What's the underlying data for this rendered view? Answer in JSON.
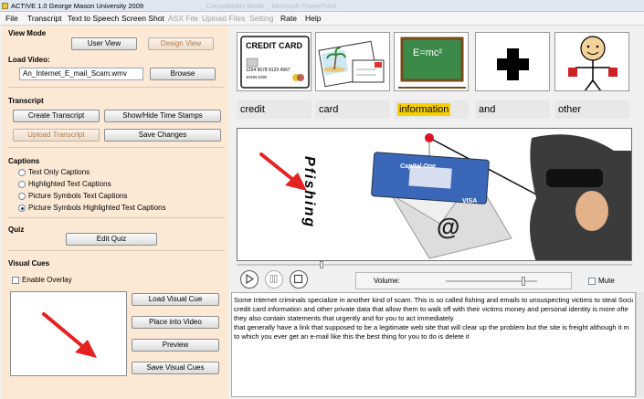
{
  "window": {
    "title": "ACTIVE 1.0 George Mason University 2009",
    "title_overflow": "_ Compatibility Mode _ Microsoft PowerPoint"
  },
  "menu": [
    "File",
    "Transcript",
    "Text to Speech",
    "Screen Shot",
    "ASX File",
    "Upload Files",
    "Setting",
    "Rate",
    "Help"
  ],
  "menu_disabled": [
    "ASX File",
    "Upload Files",
    "Setting"
  ],
  "view_mode": {
    "heading": "View Mode",
    "user_view": "User View",
    "designer_view": "Design View"
  },
  "load_video": {
    "heading": "Load Video:",
    "filename": "An_Internet_E_mail_Scam.wmv",
    "browse": "Browse"
  },
  "transcript_section": {
    "heading": "Transcript",
    "create": "Create Transcript",
    "show_hide": "Show/Hide Time Stamps",
    "upload": "Upload Transcript",
    "save": "Save Changes"
  },
  "captions": {
    "heading": "Captions",
    "options": [
      "Text Only Captions",
      "Highlighted Text Captions",
      "Picture Symbols Text Captions",
      "Picture Symbols Highlighted Text Captions"
    ],
    "selected": 3
  },
  "quiz": {
    "heading": "Quiz",
    "edit": "Edit Quiz"
  },
  "visual_cues": {
    "heading": "Visual Cues",
    "enable_overlay": "Enable Overlay",
    "enable_overlay_checked": false,
    "load": "Load Visual Cue",
    "place": "Place into Video",
    "preview": "Preview",
    "save": "Save Visual Cues"
  },
  "symbols": {
    "credit_card_title": "CREDIT CARD",
    "credit_card_number": "1234 5678 9123 4567",
    "credit_card_name": "JOHN DOE",
    "formula": "E=mc²"
  },
  "words": [
    "credit",
    "card",
    "information",
    "and",
    "other"
  ],
  "highlighted_word": 2,
  "video_overlay_text": "Pfishing",
  "video_card_brand": "Capital One",
  "video_card_visa": "VISA",
  "video_email_symbol": "@",
  "player": {
    "volume_label": "Volume:",
    "volume_level": 0.85,
    "mute_label": "Mute",
    "mute_checked": false
  },
  "transcript_lines": [
    "Some Internet criminals specialize in another kind of scam. This is so called fishing and emails to unsuspecting victims to steal Social",
    "credit card information and other private data that allow them to walk off with their victims money and personal identity is more ofte",
    "they also contain statements that urgently and for you to act immediately",
    "that generally have a link that supposed to be a legitimate web site that will clear up the problem but the site is freight although it m",
    "to which you ever get an e-mail like this the best thing for you to do is delete it"
  ],
  "colors": {
    "left_panel": "#fbe9d6",
    "highlight": "#f6d000",
    "arrow": "#e52222"
  }
}
